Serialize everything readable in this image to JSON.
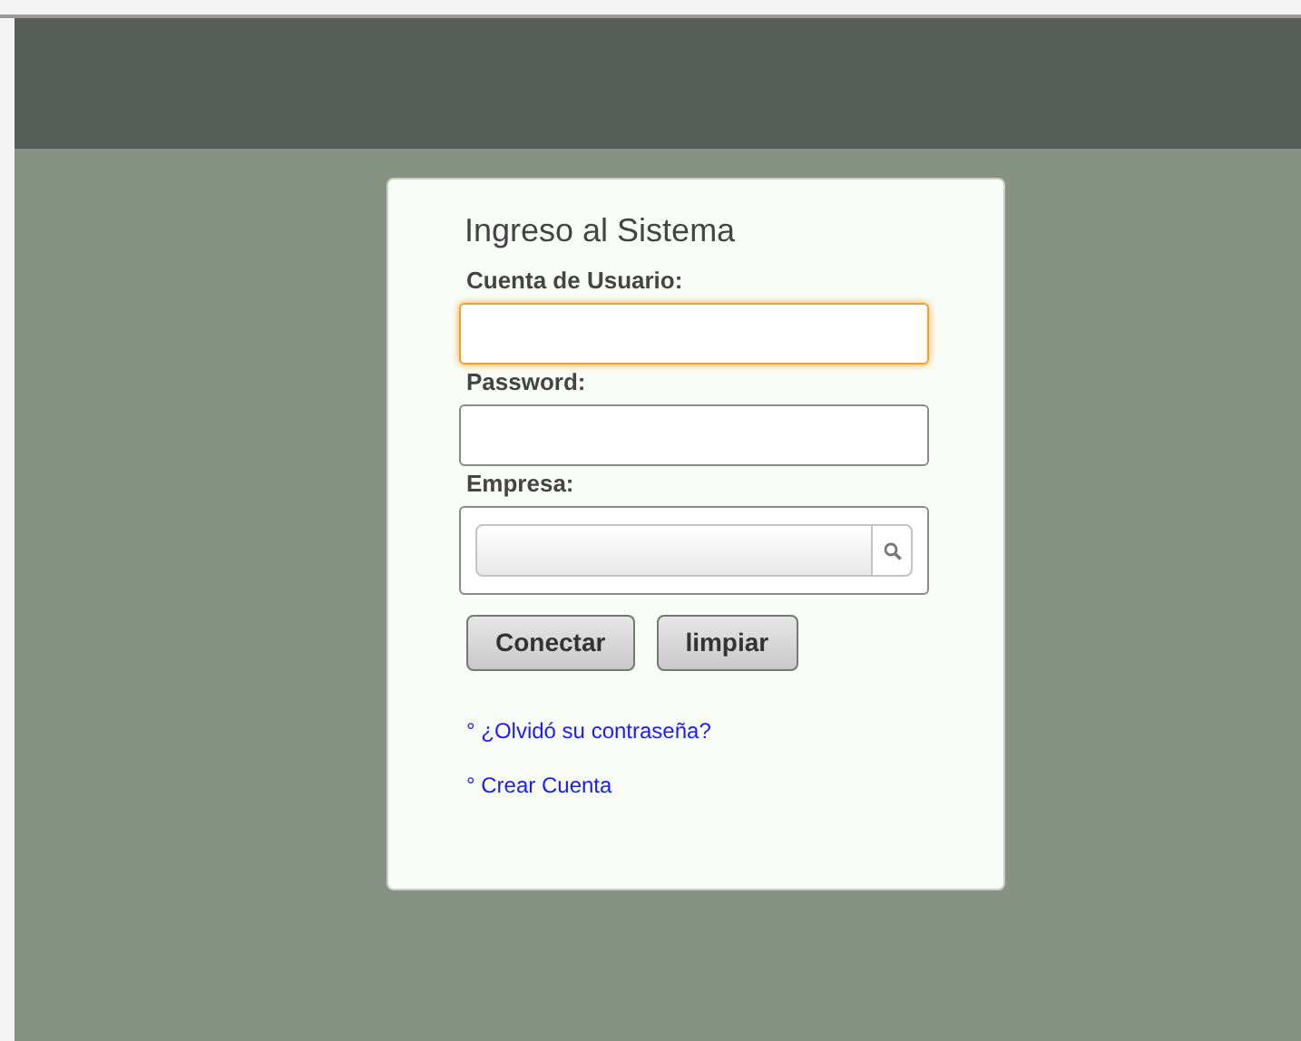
{
  "login": {
    "title": "Ingreso al Sistema",
    "fields": [
      {
        "kind": "text",
        "label": "Cuenta de Usuario:",
        "focused": true
      },
      {
        "kind": "password",
        "label": "Password:",
        "focused": false
      },
      {
        "kind": "lookup",
        "label": "Empresa:",
        "focused": false
      }
    ],
    "buttons": [
      "Conectar",
      "limpiar"
    ],
    "links": [
      "° ¿Olvidó su contraseña?",
      "° Crear Cuenta"
    ]
  }
}
